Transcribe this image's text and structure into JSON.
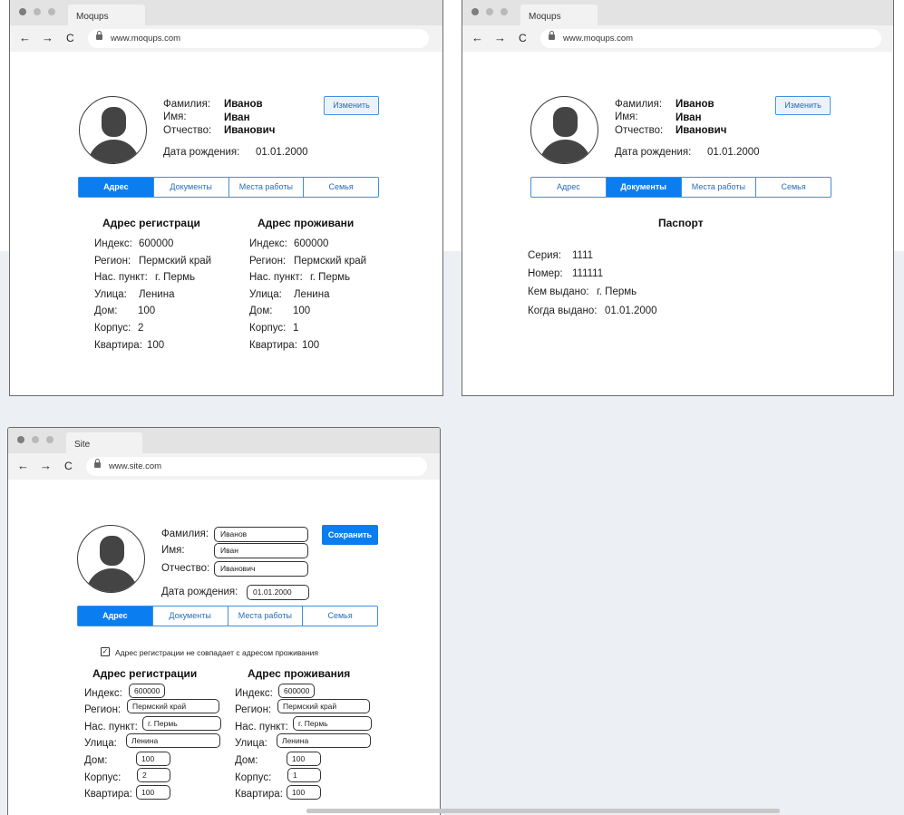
{
  "windows": [
    {
      "tab_title": "Moqups",
      "url": "www.moqups.com",
      "person": {
        "lastname_label": "Фамилия:",
        "lastname": "Иванов",
        "firstname_label": "Имя:",
        "firstname": "Иван",
        "patronymic_label": "Отчество:",
        "patronymic": "Иванович",
        "birthdate_label": "Дата рождения:",
        "birthdate": "01.01.2000"
      },
      "edit_button": "Изменить",
      "tabs": [
        "Адрес",
        "Документы",
        "Места работы",
        "Семья"
      ],
      "active_tab": 0,
      "addresses": [
        {
          "title": "Адрес регистраци",
          "rows": [
            {
              "label": "Индекс:",
              "value": "600000"
            },
            {
              "label": "Регион:",
              "value": "Пермский край"
            },
            {
              "label": "Нас. пункт:",
              "value": "г. Пермь"
            },
            {
              "label": "Улица:",
              "value": "Ленина"
            },
            {
              "label": "Дом:",
              "value": "100"
            },
            {
              "label": "Корпус:",
              "value": "2"
            },
            {
              "label": "Квартира:",
              "value": "100"
            }
          ]
        },
        {
          "title": "Адрес проживани",
          "rows": [
            {
              "label": "Индекс:",
              "value": "600000"
            },
            {
              "label": "Регион:",
              "value": "Пермский край"
            },
            {
              "label": "Нас. пункт:",
              "value": "г. Пермь"
            },
            {
              "label": "Улица:",
              "value": "Ленина"
            },
            {
              "label": "Дом:",
              "value": "100"
            },
            {
              "label": "Корпус:",
              "value": "1"
            },
            {
              "label": "Квартира:",
              "value": "100"
            }
          ]
        }
      ]
    },
    {
      "tab_title": "Moqups",
      "url": "www.moqups.com",
      "person": {
        "lastname_label": "Фамилия:",
        "lastname": "Иванов",
        "firstname_label": "Имя:",
        "firstname": "Иван",
        "patronymic_label": "Отчество:",
        "patronymic": "Иванович",
        "birthdate_label": "Дата рождения:",
        "birthdate": "01.01.2000"
      },
      "edit_button": "Изменить",
      "tabs": [
        "Адрес",
        "Документы",
        "Места работы",
        "Семья"
      ],
      "active_tab": 1,
      "passport": {
        "title": "Паспорт",
        "rows": [
          {
            "label": "Серия:",
            "value": "1111"
          },
          {
            "label": "Номер:",
            "value": "111111"
          },
          {
            "label": "Кем выдано:",
            "value": "г. Пермь"
          },
          {
            "label": "Когда выдано:",
            "value": "01.01.2000"
          }
        ]
      }
    },
    {
      "tab_title": "Site",
      "url": "www.site.com",
      "person": {
        "lastname_label": "Фамилия:",
        "lastname": "Иванов",
        "firstname_label": "Имя:",
        "firstname": "Иван",
        "patronymic_label": "Отчество:",
        "patronymic": "Иванович",
        "birthdate_label": "Дата рождения:",
        "birthdate": "01.01.2000"
      },
      "save_button": "Сохранить",
      "tabs": [
        "Адрес",
        "Документы",
        "Места работы",
        "Семья"
      ],
      "active_tab": 0,
      "checkbox": {
        "checked": true,
        "mark": "✓",
        "label": "Адрес регистрации не совпадает с адресом проживания"
      },
      "addresses": [
        {
          "title": "Адрес регистрации",
          "rows": [
            {
              "label": "Индекс:",
              "value": "600000"
            },
            {
              "label": "Регион:",
              "value": "Пермский край"
            },
            {
              "label": "Нас. пункт:",
              "value": "г. Пермь"
            },
            {
              "label": "Улица:",
              "value": "Ленина"
            },
            {
              "label": "Дом:",
              "value": "100"
            },
            {
              "label": "Корпус:",
              "value": "2"
            },
            {
              "label": "Квартира:",
              "value": "100"
            }
          ]
        },
        {
          "title": "Адрес проживания",
          "rows": [
            {
              "label": "Индекс:",
              "value": "600000"
            },
            {
              "label": "Регион:",
              "value": "Пермский край"
            },
            {
              "label": "Нас. пункт:",
              "value": "г. Пермь"
            },
            {
              "label": "Улица:",
              "value": "Ленина"
            },
            {
              "label": "Дом:",
              "value": "100"
            },
            {
              "label": "Корпус:",
              "value": "1"
            },
            {
              "label": "Квартира:",
              "value": "100"
            }
          ]
        }
      ]
    }
  ],
  "icons": {
    "back": "←",
    "forward": "→",
    "reload": "C"
  }
}
